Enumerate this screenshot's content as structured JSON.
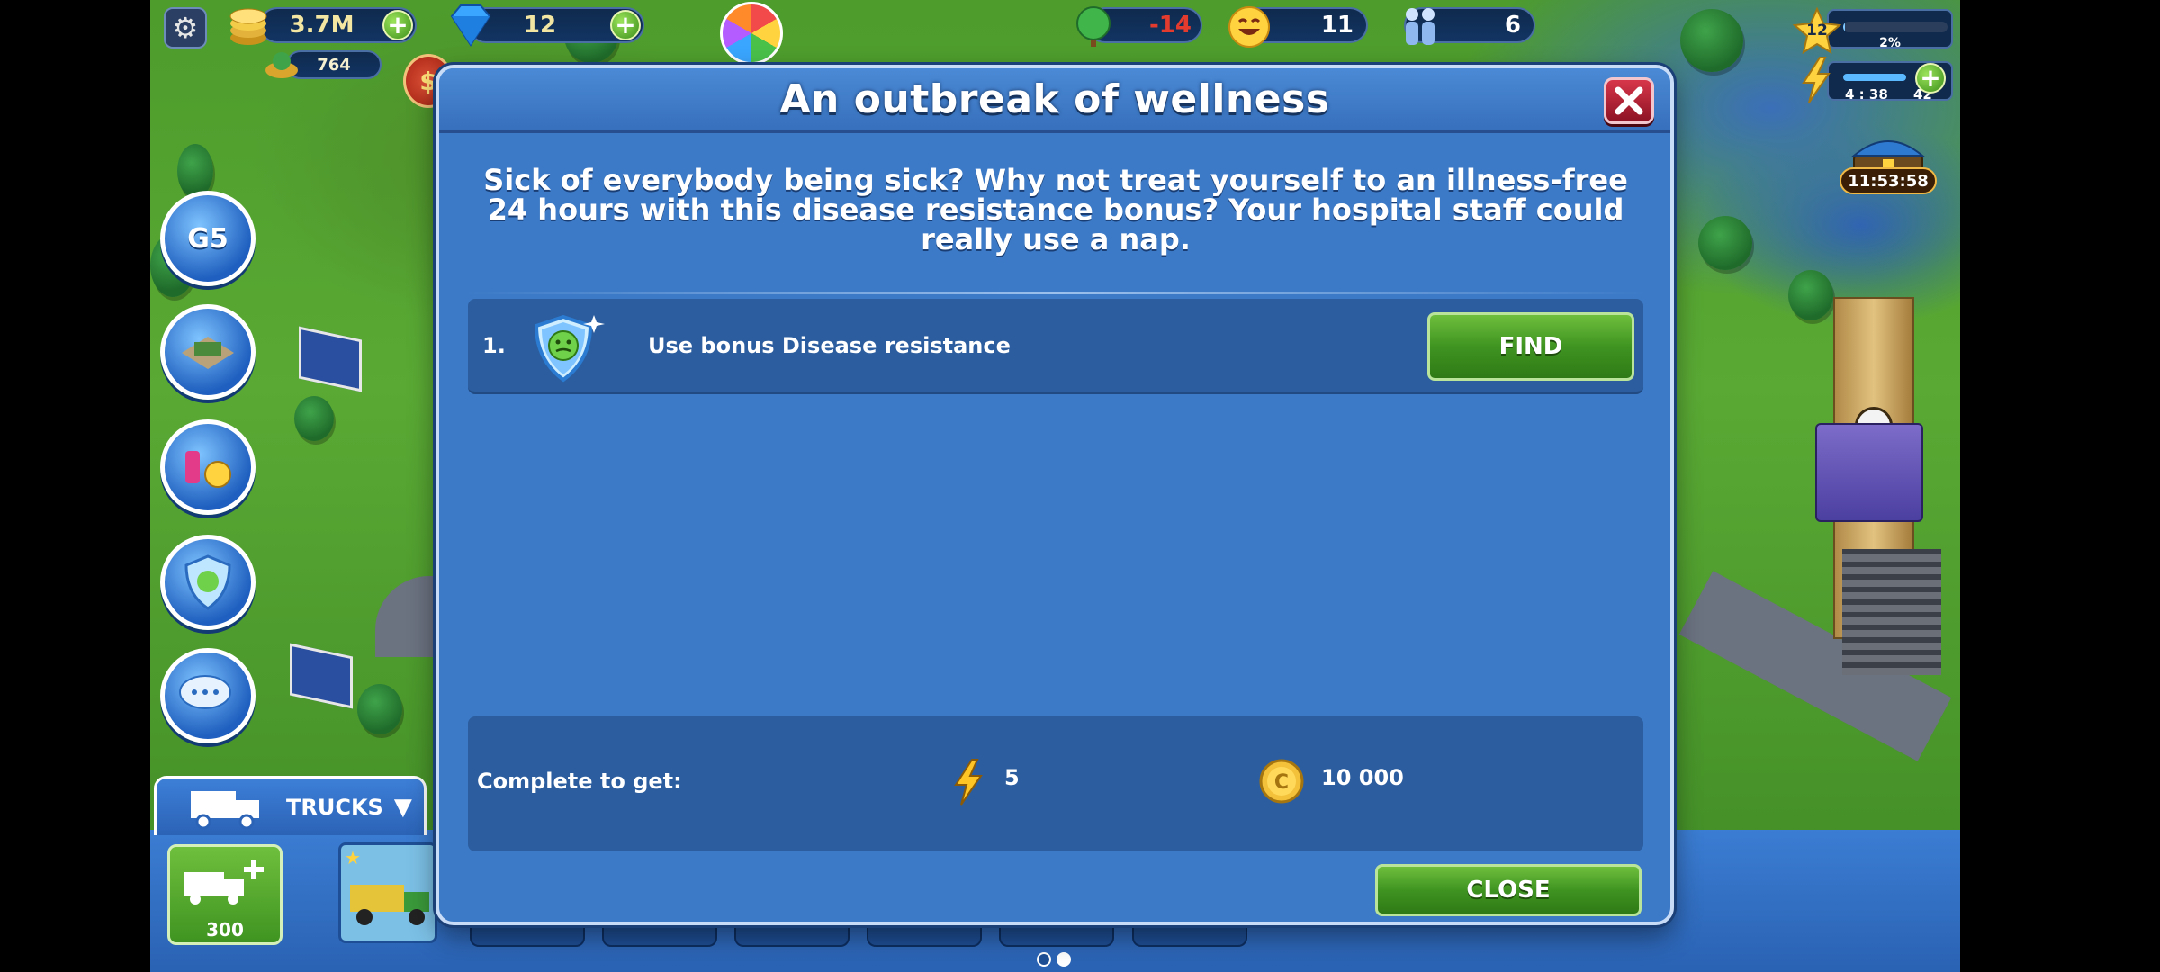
{
  "hud": {
    "coins": "3.7M",
    "gems": "12",
    "population_gold": "764",
    "ecology": "-14",
    "happiness": "11",
    "people": "6",
    "level": "12",
    "level_progress_text": "2%",
    "level_progress": 0.02,
    "energy_timer": "4 : 38",
    "energy_value": "42",
    "chest_timer": "11:53:58"
  },
  "dialog": {
    "title": "An outbreak of wellness",
    "description": "Sick of everybody being sick? Why not treat yourself to an illness-free 24 hours with this disease resistance bonus? Your hospital staff could really use a nap.",
    "tasks": [
      {
        "number": "1.",
        "label": "Use bonus Disease resistance",
        "button": "FIND",
        "icon": "disease-resistance-shield-icon"
      }
    ],
    "reward": {
      "label": "Complete to get:",
      "energy": "5",
      "coins": "10 000"
    },
    "close_button": "CLOSE"
  },
  "bottom": {
    "trucks_label": "TRUCKS",
    "buy_truck_price": "300"
  },
  "colors": {
    "dialog_bg": "#3c7ac7",
    "panel_bg": "#2c5d9e",
    "button_green": "#3f9421",
    "close_red": "#c12a3e",
    "ecology_negative": "#e33b2e"
  }
}
